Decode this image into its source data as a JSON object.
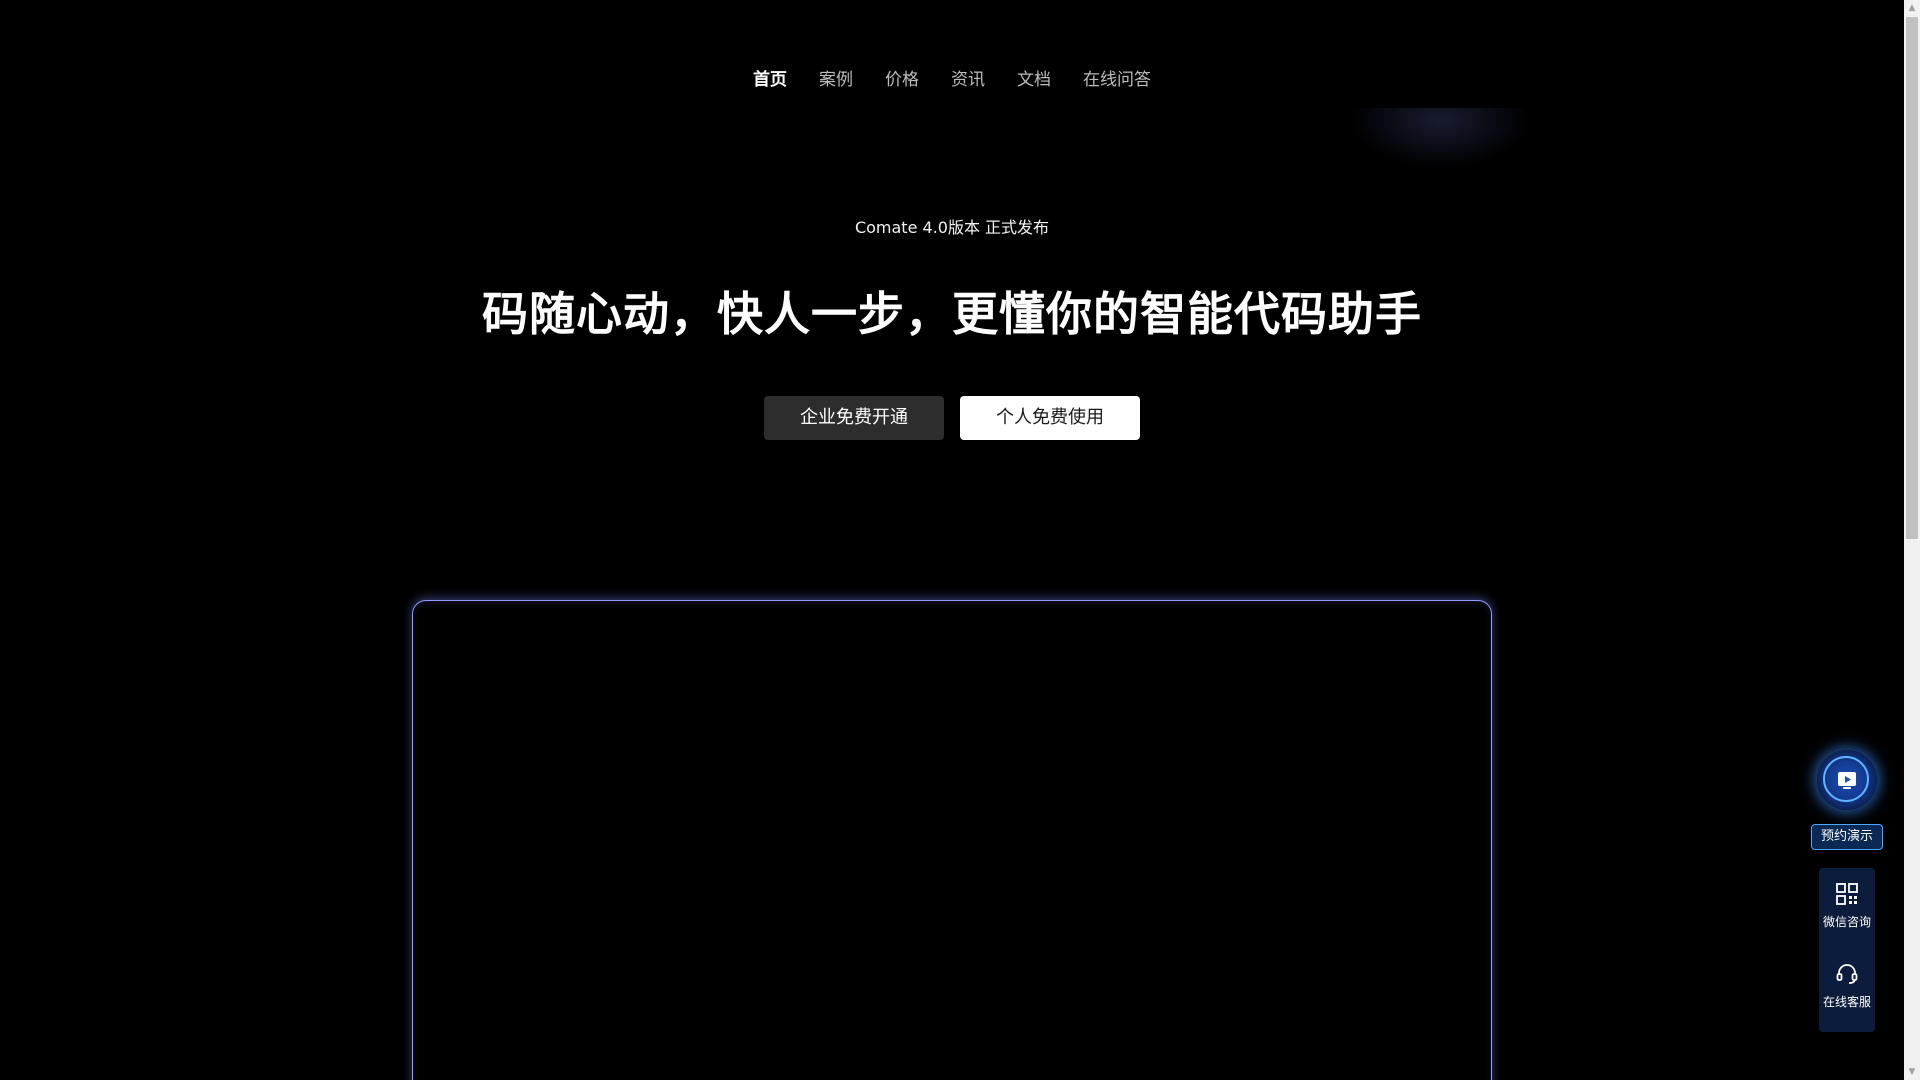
{
  "nav": {
    "items": [
      {
        "label": "首页",
        "active": true
      },
      {
        "label": "案例",
        "active": false
      },
      {
        "label": "价格",
        "active": false
      },
      {
        "label": "资讯",
        "active": false
      },
      {
        "label": "文档",
        "active": false
      },
      {
        "label": "在线问答",
        "active": false
      }
    ]
  },
  "hero": {
    "tag": "Comate 4.0版本 正式发布",
    "title": "码随心动，快人一步，更懂你的智能代码助手",
    "buttons": {
      "enterprise": "企业免费开通",
      "personal": "个人免费使用"
    }
  },
  "floating": {
    "demo_label": "预约演示",
    "demo_icon": "play-icon",
    "wechat_label": "微信咨询",
    "wechat_icon": "qr-code-icon",
    "service_label": "在线客服",
    "service_icon": "headset-icon"
  },
  "colors": {
    "background": "#000000",
    "frame_border": "#8f9bff",
    "accent_blue": "#4aa8ff"
  }
}
